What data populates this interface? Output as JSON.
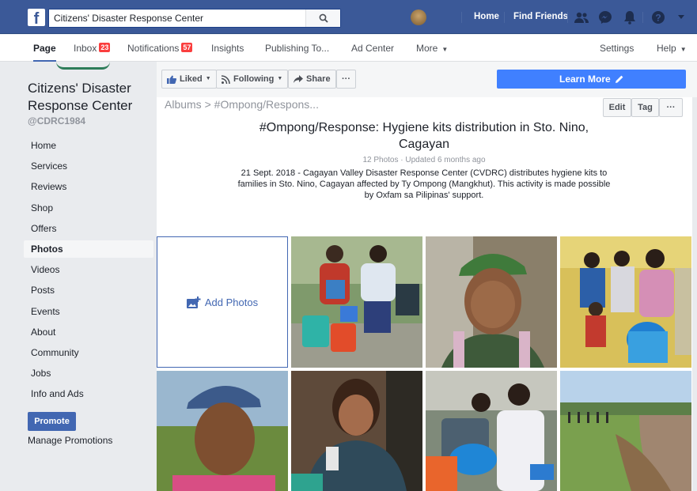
{
  "topbar": {
    "logo_letter": "f",
    "search_value": "Citizens' Disaster Response Center",
    "nav": [
      "Home",
      "Find Friends"
    ]
  },
  "tabs": [
    {
      "label": "Page",
      "active": true
    },
    {
      "label": "Inbox",
      "badge": "23"
    },
    {
      "label": "Notifications",
      "badge": "57"
    },
    {
      "label": "Insights"
    },
    {
      "label": "Publishing To..."
    },
    {
      "label": "Ad Center"
    },
    {
      "label": "More"
    },
    {
      "label": "Settings"
    },
    {
      "label": "Help"
    }
  ],
  "page": {
    "name": "Citizens' Disaster Response Center",
    "handle": "@CDRC1984"
  },
  "sidebar": {
    "items": [
      "Home",
      "Services",
      "Reviews",
      "Shop",
      "Offers",
      "Photos",
      "Videos",
      "Posts",
      "Events",
      "About",
      "Community",
      "Jobs",
      "Info and Ads"
    ],
    "active": "Photos",
    "promote": "Promote",
    "manage": "Manage Promotions"
  },
  "actions": {
    "liked": "Liked",
    "following": "Following",
    "share": "Share",
    "more": "···",
    "learn_more": "Learn More"
  },
  "album": {
    "breadcrumb_root": "Albums",
    "breadcrumb_sep": ">",
    "breadcrumb_current": "#Ompong/Respons...",
    "edit": "Edit",
    "tag": "Tag",
    "more": "···",
    "title": "#Ompong/Response: Hygiene kits distribution in Sto. Nino, Cagayan",
    "meta": "12 Photos · Updated 6 months ago",
    "description": "21 Sept. 2018 - Cagayan Valley Disaster Response Center (CVDRC) distributes hygiene kits to families in Sto. Nino, Cagayan affected by Ty Ompong (Mangkhut). This activity is made possible by Oxfam sa Pilipinas' support.",
    "add_photos": "Add Photos"
  },
  "colors": {
    "fb_blue": "#3b5998",
    "button_blue": "#4267b2",
    "learn_more_blue": "#4080ff",
    "badge_red": "#fa3e3e"
  }
}
